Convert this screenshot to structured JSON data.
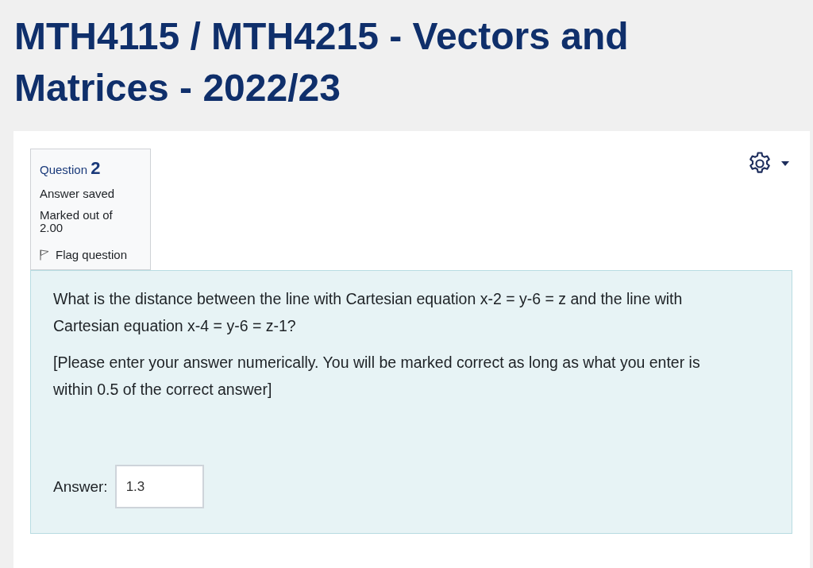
{
  "page_title": "MTH4115 / MTH4215 - Vectors and Matrices - 2022/23",
  "question_info": {
    "heading": "Question **2**",
    "state": "Answer saved",
    "grade": "Marked out of 2.00",
    "flag": {
      "label": "Flag question",
      "flagged": false
    }
  },
  "question": {
    "paragraphs": [
      "What is the distance between the line with Cartesian equation x-2 = y-6 = z and the line with Cartesian equation x-4 = y-6 = z-1?",
      "[Please enter your answer numerically. You will be marked correct as long as what you enter is within 0.5 of the correct answer]"
    ],
    "answer": {
      "label": "Answer:",
      "value": "1.3"
    }
  }
}
